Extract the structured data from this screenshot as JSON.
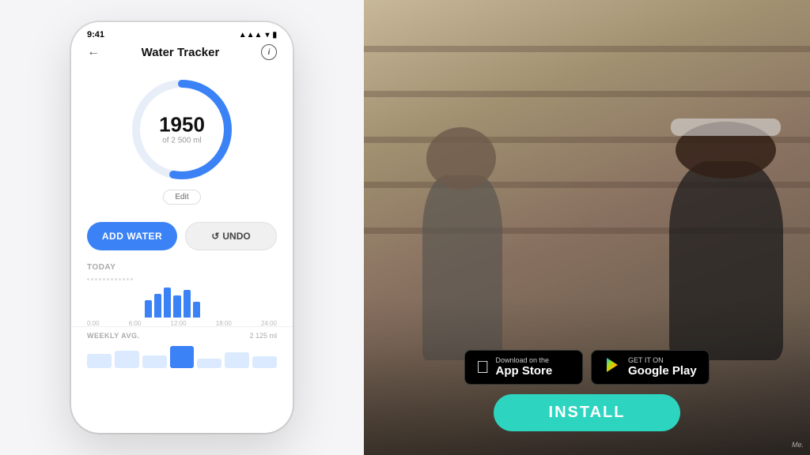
{
  "phone": {
    "status_time": "9:41",
    "screen_title": "Water Tracker",
    "water_amount": "1950",
    "water_of": "of 2 500 ml",
    "edit_label": "Edit",
    "add_water_label": "ADD WATER",
    "undo_label": "UNDO",
    "today_label": "TODAY",
    "weekly_label": "WEEKLY AVG.",
    "weekly_value": "2 125 ml",
    "time_labels": [
      "0:00",
      "6:00",
      "12:00",
      "18:00",
      "24:00"
    ]
  },
  "cta": {
    "app_store_top": "Download on the",
    "app_store_bottom": "App Store",
    "google_play_top": "GET IT ON",
    "google_play_bottom": "Google Play",
    "install_label": "INSTALL"
  },
  "watermark": "Me."
}
